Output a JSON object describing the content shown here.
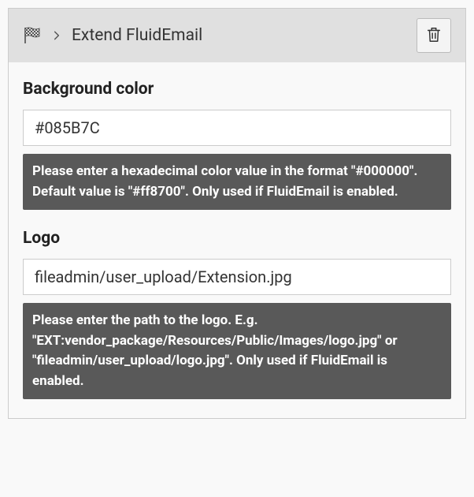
{
  "header": {
    "title": "Extend FluidEmail"
  },
  "fields": {
    "backgroundColor": {
      "label": "Background color",
      "value": "#085B7C",
      "hint": "Please enter a hexadecimal color value in the format \"#000000\". Default value is \"#ff8700\". Only used if FluidEmail is enabled."
    },
    "logo": {
      "label": "Logo",
      "value": "fileadmin/user_upload/Extension.jpg",
      "hint": "Please enter the path to the logo. E.g. \"EXT:vendor_package/Resources/Public/Images/logo.jpg\" or \"fileadmin/user_upload/logo.jpg\". Only used if FluidEmail is enabled."
    }
  }
}
